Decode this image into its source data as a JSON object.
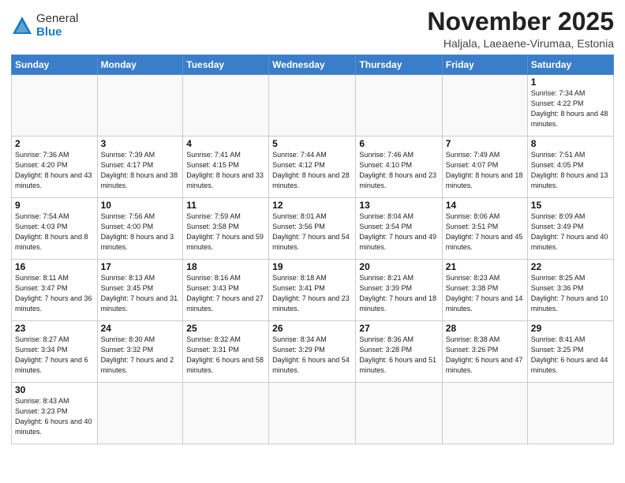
{
  "header": {
    "logo_general": "General",
    "logo_blue": "Blue",
    "month": "November 2025",
    "location": "Haljala, Laeaene-Virumaa, Estonia"
  },
  "weekdays": [
    "Sunday",
    "Monday",
    "Tuesday",
    "Wednesday",
    "Thursday",
    "Friday",
    "Saturday"
  ],
  "weeks": [
    [
      {
        "day": "",
        "info": ""
      },
      {
        "day": "",
        "info": ""
      },
      {
        "day": "",
        "info": ""
      },
      {
        "day": "",
        "info": ""
      },
      {
        "day": "",
        "info": ""
      },
      {
        "day": "",
        "info": ""
      },
      {
        "day": "1",
        "info": "Sunrise: 7:34 AM\nSunset: 4:22 PM\nDaylight: 8 hours\nand 48 minutes."
      }
    ],
    [
      {
        "day": "2",
        "info": "Sunrise: 7:36 AM\nSunset: 4:20 PM\nDaylight: 8 hours\nand 43 minutes."
      },
      {
        "day": "3",
        "info": "Sunrise: 7:39 AM\nSunset: 4:17 PM\nDaylight: 8 hours\nand 38 minutes."
      },
      {
        "day": "4",
        "info": "Sunrise: 7:41 AM\nSunset: 4:15 PM\nDaylight: 8 hours\nand 33 minutes."
      },
      {
        "day": "5",
        "info": "Sunrise: 7:44 AM\nSunset: 4:12 PM\nDaylight: 8 hours\nand 28 minutes."
      },
      {
        "day": "6",
        "info": "Sunrise: 7:46 AM\nSunset: 4:10 PM\nDaylight: 8 hours\nand 23 minutes."
      },
      {
        "day": "7",
        "info": "Sunrise: 7:49 AM\nSunset: 4:07 PM\nDaylight: 8 hours\nand 18 minutes."
      },
      {
        "day": "8",
        "info": "Sunrise: 7:51 AM\nSunset: 4:05 PM\nDaylight: 8 hours\nand 13 minutes."
      }
    ],
    [
      {
        "day": "9",
        "info": "Sunrise: 7:54 AM\nSunset: 4:03 PM\nDaylight: 8 hours\nand 8 minutes."
      },
      {
        "day": "10",
        "info": "Sunrise: 7:56 AM\nSunset: 4:00 PM\nDaylight: 8 hours\nand 3 minutes."
      },
      {
        "day": "11",
        "info": "Sunrise: 7:59 AM\nSunset: 3:58 PM\nDaylight: 7 hours\nand 59 minutes."
      },
      {
        "day": "12",
        "info": "Sunrise: 8:01 AM\nSunset: 3:56 PM\nDaylight: 7 hours\nand 54 minutes."
      },
      {
        "day": "13",
        "info": "Sunrise: 8:04 AM\nSunset: 3:54 PM\nDaylight: 7 hours\nand 49 minutes."
      },
      {
        "day": "14",
        "info": "Sunrise: 8:06 AM\nSunset: 3:51 PM\nDaylight: 7 hours\nand 45 minutes."
      },
      {
        "day": "15",
        "info": "Sunrise: 8:09 AM\nSunset: 3:49 PM\nDaylight: 7 hours\nand 40 minutes."
      }
    ],
    [
      {
        "day": "16",
        "info": "Sunrise: 8:11 AM\nSunset: 3:47 PM\nDaylight: 7 hours\nand 36 minutes."
      },
      {
        "day": "17",
        "info": "Sunrise: 8:13 AM\nSunset: 3:45 PM\nDaylight: 7 hours\nand 31 minutes."
      },
      {
        "day": "18",
        "info": "Sunrise: 8:16 AM\nSunset: 3:43 PM\nDaylight: 7 hours\nand 27 minutes."
      },
      {
        "day": "19",
        "info": "Sunrise: 8:18 AM\nSunset: 3:41 PM\nDaylight: 7 hours\nand 23 minutes."
      },
      {
        "day": "20",
        "info": "Sunrise: 8:21 AM\nSunset: 3:39 PM\nDaylight: 7 hours\nand 18 minutes."
      },
      {
        "day": "21",
        "info": "Sunrise: 8:23 AM\nSunset: 3:38 PM\nDaylight: 7 hours\nand 14 minutes."
      },
      {
        "day": "22",
        "info": "Sunrise: 8:25 AM\nSunset: 3:36 PM\nDaylight: 7 hours\nand 10 minutes."
      }
    ],
    [
      {
        "day": "23",
        "info": "Sunrise: 8:27 AM\nSunset: 3:34 PM\nDaylight: 7 hours\nand 6 minutes."
      },
      {
        "day": "24",
        "info": "Sunrise: 8:30 AM\nSunset: 3:32 PM\nDaylight: 7 hours\nand 2 minutes."
      },
      {
        "day": "25",
        "info": "Sunrise: 8:32 AM\nSunset: 3:31 PM\nDaylight: 6 hours\nand 58 minutes."
      },
      {
        "day": "26",
        "info": "Sunrise: 8:34 AM\nSunset: 3:29 PM\nDaylight: 6 hours\nand 54 minutes."
      },
      {
        "day": "27",
        "info": "Sunrise: 8:36 AM\nSunset: 3:28 PM\nDaylight: 6 hours\nand 51 minutes."
      },
      {
        "day": "28",
        "info": "Sunrise: 8:38 AM\nSunset: 3:26 PM\nDaylight: 6 hours\nand 47 minutes."
      },
      {
        "day": "29",
        "info": "Sunrise: 8:41 AM\nSunset: 3:25 PM\nDaylight: 6 hours\nand 44 minutes."
      }
    ],
    [
      {
        "day": "30",
        "info": "Sunrise: 8:43 AM\nSunset: 3:23 PM\nDaylight: 6 hours\nand 40 minutes."
      },
      {
        "day": "",
        "info": ""
      },
      {
        "day": "",
        "info": ""
      },
      {
        "day": "",
        "info": ""
      },
      {
        "day": "",
        "info": ""
      },
      {
        "day": "",
        "info": ""
      },
      {
        "day": "",
        "info": ""
      }
    ]
  ]
}
